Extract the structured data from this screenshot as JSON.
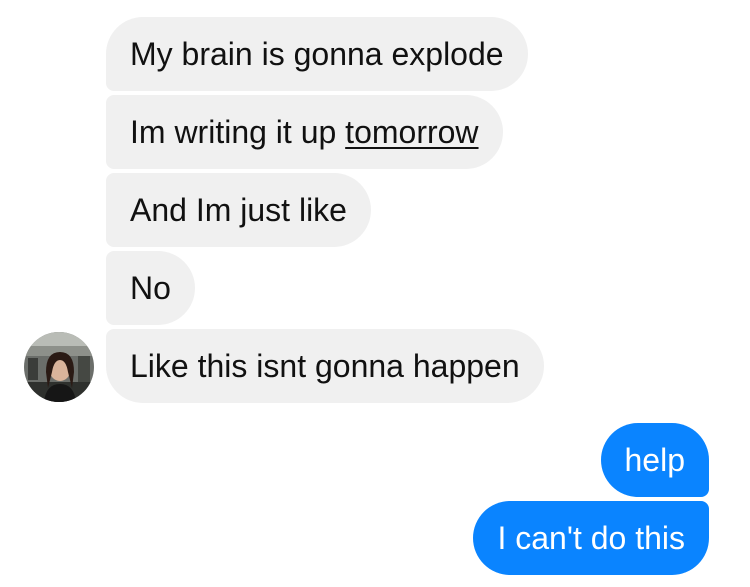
{
  "conversation": {
    "incoming": [
      {
        "text": "My brain is gonna explode"
      },
      {
        "text_before_link": "Im writing it up ",
        "link": "tomorrow"
      },
      {
        "text": "And Im just like"
      },
      {
        "text": "No"
      },
      {
        "text": "Like this isnt gonna happen"
      }
    ],
    "outgoing": [
      {
        "text": "help"
      },
      {
        "text": "I can't do this"
      }
    ]
  },
  "sender": {
    "avatar_icon": "profile-photo-avatar"
  },
  "colors": {
    "incoming_bubble": "#f0f0f0",
    "outgoing_bubble": "#0a84ff",
    "incoming_text": "#111111",
    "outgoing_text": "#ffffff"
  }
}
